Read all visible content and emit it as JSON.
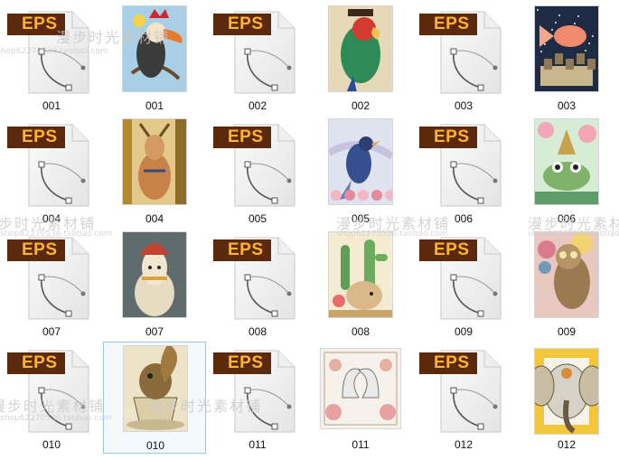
{
  "files": [
    {
      "name": "001",
      "type": "eps-file"
    },
    {
      "name": "001",
      "type": "image",
      "subject": "toucan-icon",
      "bg": "#a9cfe6"
    },
    {
      "name": "002",
      "type": "eps-file"
    },
    {
      "name": "002",
      "type": "image",
      "subject": "parrot-icon",
      "bg": "#e6d9b8"
    },
    {
      "name": "003",
      "type": "eps-file"
    },
    {
      "name": "003",
      "type": "image",
      "subject": "goldfish-night-icon",
      "bg": "#1f2a44"
    },
    {
      "name": "004",
      "type": "eps-file"
    },
    {
      "name": "004",
      "type": "image",
      "subject": "deer-icon",
      "bg": "#e2c98a"
    },
    {
      "name": "005",
      "type": "eps-file"
    },
    {
      "name": "005",
      "type": "image",
      "subject": "bird-branch-icon",
      "bg": "#dfe3f0"
    },
    {
      "name": "006",
      "type": "eps-file"
    },
    {
      "name": "006",
      "type": "image",
      "subject": "frog-lotus-icon",
      "bg": "#d6ecd5"
    },
    {
      "name": "007",
      "type": "eps-file"
    },
    {
      "name": "007",
      "type": "image",
      "subject": "llama-icon",
      "bg": "#5f6b6c"
    },
    {
      "name": "008",
      "type": "eps-file"
    },
    {
      "name": "008",
      "type": "image",
      "subject": "cactus-hedgehog-icon",
      "bg": "#f3ecd2"
    },
    {
      "name": "009",
      "type": "eps-file"
    },
    {
      "name": "009",
      "type": "image",
      "subject": "owl-flowers-icon",
      "bg": "#e8c8c0"
    },
    {
      "name": "010",
      "type": "eps-file"
    },
    {
      "name": "010",
      "type": "image",
      "subject": "squirrel-teacup-icon",
      "bg": "#ece3c9",
      "selected": true
    },
    {
      "name": "011",
      "type": "eps-file"
    },
    {
      "name": "011",
      "type": "image",
      "subject": "swan-roses-icon",
      "bg": "#f6f1ea"
    },
    {
      "name": "012",
      "type": "eps-file"
    },
    {
      "name": "012",
      "type": "image",
      "subject": "elephant-icon",
      "bg": "#f2c73c"
    }
  ],
  "eps_badge_label": "EPS",
  "watermarks": {
    "main": "漫步时光素材铺",
    "url": "shop62270536.taobao.com"
  },
  "colors": {
    "badge_bg": "#5b2a0c",
    "badge_text": "#ffb32e",
    "selection_border": "#99c6f0"
  }
}
